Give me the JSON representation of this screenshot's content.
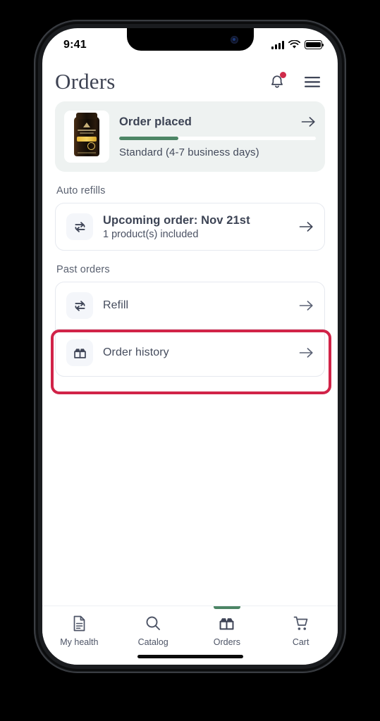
{
  "status_bar": {
    "time": "9:41",
    "signal_icon": "cellular-bars-icon",
    "wifi_icon": "wifi-icon",
    "battery_icon": "battery-icon"
  },
  "header": {
    "title": "Orders",
    "notifications_icon": "bell-icon",
    "menu_icon": "hamburger-menu-icon",
    "has_notification_badge": true
  },
  "order_status_card": {
    "product_image": "supplement-bottle-image",
    "title": "Order placed",
    "shipping": "Standard (4-7 business days)",
    "progress_percent": 30,
    "arrow_icon": "arrow-right-icon"
  },
  "auto_refills": {
    "section_label": "Auto refills",
    "row": {
      "icon": "refresh-repeat-icon",
      "title": "Upcoming order: Nov 21st",
      "subtitle": "1 product(s) included",
      "arrow_icon": "arrow-right-icon"
    }
  },
  "past_orders": {
    "section_label": "Past orders",
    "rows": [
      {
        "icon": "refresh-repeat-icon",
        "title": "Refill",
        "arrow_icon": "arrow-right-icon",
        "highlighted": true
      },
      {
        "icon": "open-box-icon",
        "title": "Order history",
        "arrow_icon": "arrow-right-icon",
        "highlighted": false
      }
    ]
  },
  "bottom_nav": {
    "items": [
      {
        "label": "My health",
        "icon": "document-icon",
        "active": false
      },
      {
        "label": "Catalog",
        "icon": "search-icon",
        "active": false
      },
      {
        "label": "Orders",
        "icon": "open-box-icon",
        "active": true
      },
      {
        "label": "Cart",
        "icon": "shopping-cart-icon",
        "active": false
      }
    ]
  },
  "colors": {
    "accent_green": "#4c8565",
    "card_tint": "#eef2f1",
    "highlight_red": "#d12348",
    "badge_red": "#cf2b4a",
    "text_primary": "#3c4354",
    "text_secondary": "#5a6170"
  }
}
